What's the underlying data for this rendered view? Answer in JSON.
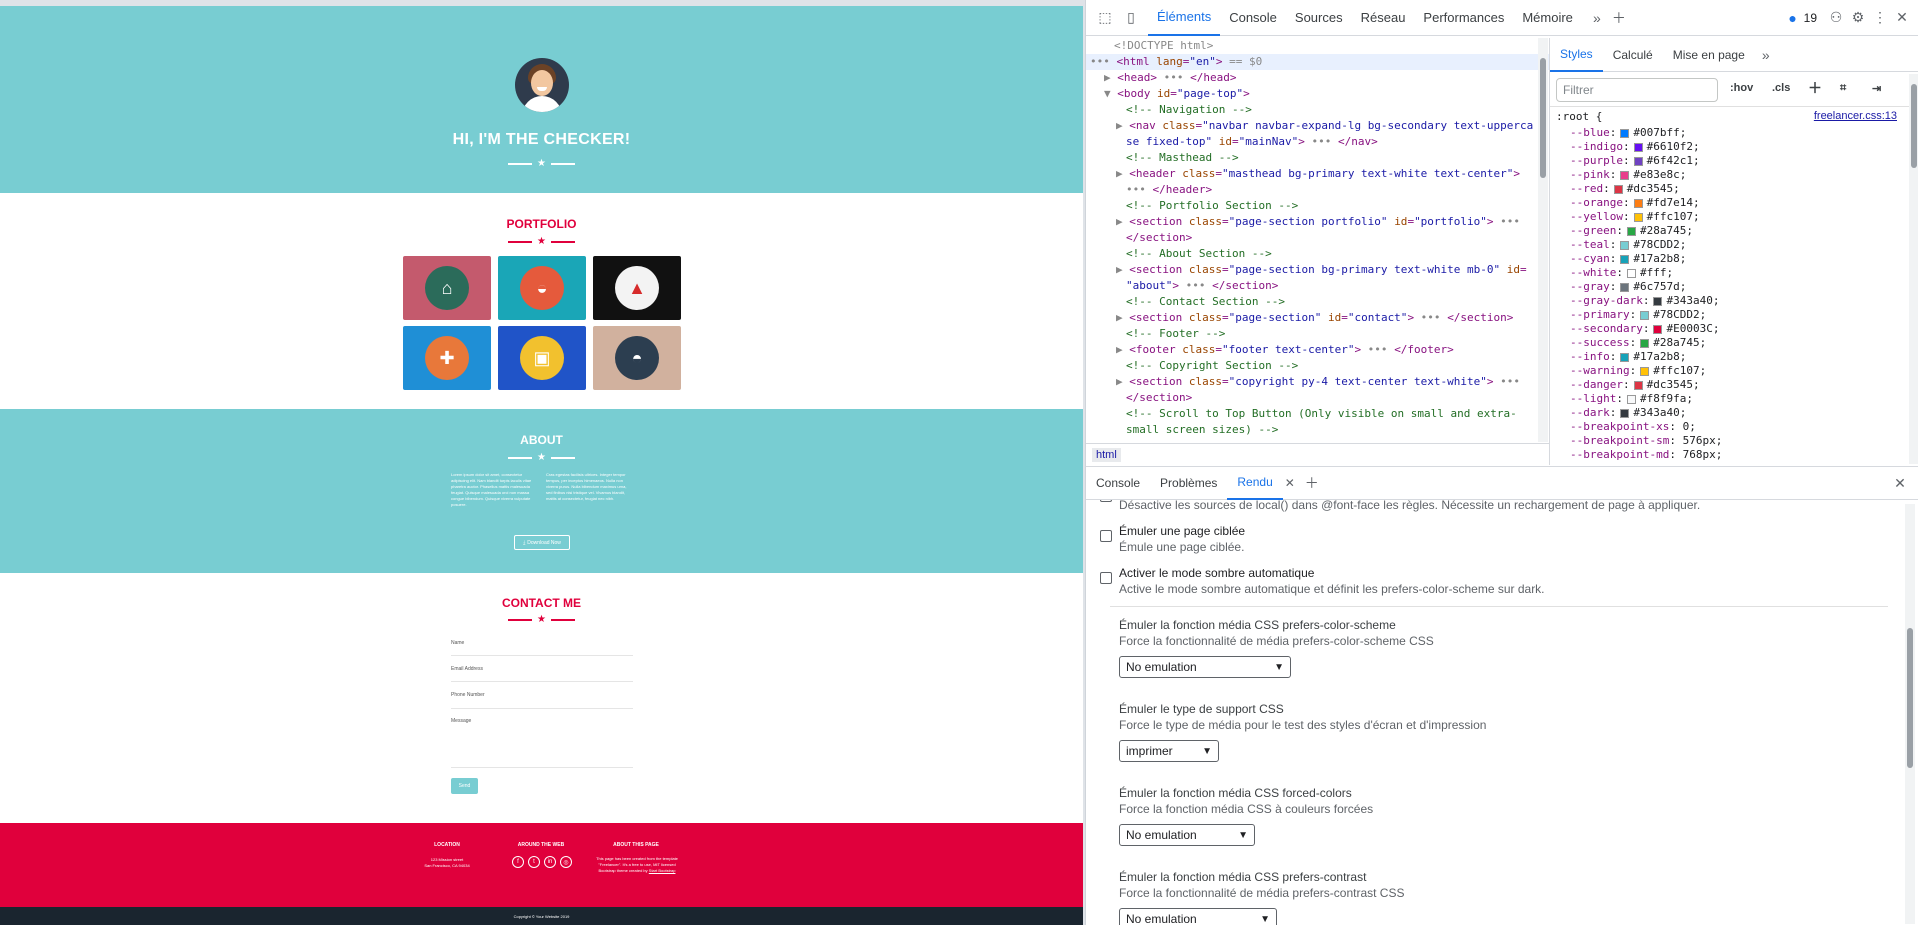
{
  "preview": {
    "masthead": {
      "title": "HI, I'M THE CHECKER!"
    },
    "portfolio": {
      "title": "PORTFOLIO",
      "items": [
        {
          "label": "cabin",
          "bg": "#C45A6D",
          "circle": "#2b6b5a",
          "glyph": "⌂"
        },
        {
          "label": "cake",
          "bg": "#1aa6b7",
          "circle": "#e55a3c",
          "glyph": "◒"
        },
        {
          "label": "circus",
          "bg": "#111111",
          "circle": "#f3f3f3",
          "glyph": "▲"
        },
        {
          "label": "game",
          "bg": "#1f8fd6",
          "circle": "#e8783a",
          "glyph": "✚"
        },
        {
          "label": "safe",
          "bg": "#2054c8",
          "circle": "#f2c12e",
          "glyph": "▣"
        },
        {
          "label": "submarine",
          "bg": "#d1b19e",
          "circle": "#2c3e50",
          "glyph": "◓"
        }
      ]
    },
    "about": {
      "title": "ABOUT",
      "col1": "Lorem ipsum dolor sit amet, consectetur adipiscing elit. Nam blandit turpis iaculis vitae pharetra auctor. Phasellus mattis malesuada feugiat. Quisque malesuada orci non massa congue bibendum. Quisque viverra vulputate posuere.",
      "col2": "Cras egestas facilisis ultrices. Integer tempor tempus, per inceptos himenaeos. Nulla non viverra purus. Nulla bibendum maximus urna, sed finibus nisi tristique vel. Vivamus blandit, mattis at consectetur, feugiat nec nibh.",
      "button": "Download Now"
    },
    "contact": {
      "title": "CONTACT ME",
      "fields": [
        "Name",
        "Email Address",
        "Phone Number",
        "Message"
      ],
      "send": "Send"
    },
    "footer": {
      "location_title": "LOCATION",
      "location_text": "123 Mission street\nSan Francisco, CA 94034",
      "web_title": "AROUND THE WEB",
      "social": [
        "f",
        "t",
        "in",
        "◎"
      ],
      "about_title": "ABOUT THIS PAGE",
      "about_text": "This page has been created from the template \"Freelancer\". It's a free to use, MIT licensed Bootstrap theme created by",
      "about_link": "Start Bootstrap",
      "copyright": "Copyright © Your Website 2019"
    }
  },
  "devtools": {
    "tabs": [
      "Éléments",
      "Console",
      "Sources",
      "Réseau",
      "Performances",
      "Mémoire"
    ],
    "issues_count": "19",
    "elements_lines": [
      {
        "indent": 1,
        "parts": [
          [
            "dim",
            "<!DOCTYPE html>"
          ]
        ]
      },
      {
        "indent": 0,
        "prefix": "••• ",
        "selected": true,
        "parts": [
          [
            "tag",
            "<html "
          ],
          [
            "attr",
            "lang"
          ],
          [
            "tag",
            "="
          ],
          [
            "val",
            "\"en\""
          ],
          [
            "tag",
            ">"
          ],
          [
            "dim",
            " == $0"
          ]
        ]
      },
      {
        "indent": 1,
        "prefix": "▶ ",
        "parts": [
          [
            "tag",
            "<head>"
          ],
          [
            "dim",
            " ••• "
          ],
          [
            "tag",
            "</head>"
          ]
        ]
      },
      {
        "indent": 1,
        "prefix": "▼ ",
        "parts": [
          [
            "tag",
            "<body "
          ],
          [
            "attr",
            "id"
          ],
          [
            "tag",
            "="
          ],
          [
            "val",
            "\"page-top\""
          ],
          [
            "tag",
            ">"
          ]
        ]
      },
      {
        "indent": 2,
        "parts": [
          [
            "cmt",
            "<!-- Navigation -->"
          ]
        ]
      },
      {
        "indent": 2,
        "prefix": "▶ ",
        "parts": [
          [
            "tag",
            "<nav "
          ],
          [
            "attr",
            "class"
          ],
          [
            "tag",
            "="
          ],
          [
            "val",
            "\"navbar navbar-expand-lg bg-secondary text-upperca"
          ]
        ]
      },
      {
        "indent": 2,
        "parts": [
          [
            "val",
            "se fixed-top\" "
          ],
          [
            "attr",
            "id"
          ],
          [
            "tag",
            "="
          ],
          [
            "val",
            "\"mainNav\""
          ],
          [
            "tag",
            ">"
          ],
          [
            "dim",
            " ••• "
          ],
          [
            "tag",
            "</nav>"
          ]
        ]
      },
      {
        "indent": 2,
        "parts": [
          [
            "cmt",
            "<!-- Masthead -->"
          ]
        ]
      },
      {
        "indent": 2,
        "prefix": "▶ ",
        "parts": [
          [
            "tag",
            "<header "
          ],
          [
            "attr",
            "class"
          ],
          [
            "tag",
            "="
          ],
          [
            "val",
            "\"masthead bg-primary text-white text-center\""
          ],
          [
            "tag",
            ">"
          ]
        ]
      },
      {
        "indent": 2,
        "parts": [
          [
            "dim",
            "••• "
          ],
          [
            "tag",
            "</header>"
          ]
        ]
      },
      {
        "indent": 2,
        "parts": [
          [
            "cmt",
            "<!-- Portfolio Section -->"
          ]
        ]
      },
      {
        "indent": 2,
        "prefix": "▶ ",
        "parts": [
          [
            "tag",
            "<section "
          ],
          [
            "attr",
            "class"
          ],
          [
            "tag",
            "="
          ],
          [
            "val",
            "\"page-section portfolio\" "
          ],
          [
            "attr",
            "id"
          ],
          [
            "tag",
            "="
          ],
          [
            "val",
            "\"portfolio\""
          ],
          [
            "tag",
            ">"
          ],
          [
            "dim",
            " •••"
          ]
        ]
      },
      {
        "indent": 2,
        "parts": [
          [
            "tag",
            "</section>"
          ]
        ]
      },
      {
        "indent": 2,
        "parts": [
          [
            "cmt",
            "<!-- About Section -->"
          ]
        ]
      },
      {
        "indent": 2,
        "prefix": "▶ ",
        "parts": [
          [
            "tag",
            "<section "
          ],
          [
            "attr",
            "class"
          ],
          [
            "tag",
            "="
          ],
          [
            "val",
            "\"page-section bg-primary text-white mb-0\" "
          ],
          [
            "attr",
            "id"
          ],
          [
            "tag",
            "="
          ]
        ]
      },
      {
        "indent": 2,
        "parts": [
          [
            "val",
            "\"about\""
          ],
          [
            "tag",
            ">"
          ],
          [
            "dim",
            " ••• "
          ],
          [
            "tag",
            "</section>"
          ]
        ]
      },
      {
        "indent": 2,
        "parts": [
          [
            "cmt",
            "<!-- Contact Section -->"
          ]
        ]
      },
      {
        "indent": 2,
        "prefix": "▶ ",
        "parts": [
          [
            "tag",
            "<section "
          ],
          [
            "attr",
            "class"
          ],
          [
            "tag",
            "="
          ],
          [
            "val",
            "\"page-section\" "
          ],
          [
            "attr",
            "id"
          ],
          [
            "tag",
            "="
          ],
          [
            "val",
            "\"contact\""
          ],
          [
            "tag",
            ">"
          ],
          [
            "dim",
            " ••• "
          ],
          [
            "tag",
            "</section>"
          ]
        ]
      },
      {
        "indent": 2,
        "parts": [
          [
            "cmt",
            "<!-- Footer -->"
          ]
        ]
      },
      {
        "indent": 2,
        "prefix": "▶ ",
        "parts": [
          [
            "tag",
            "<footer "
          ],
          [
            "attr",
            "class"
          ],
          [
            "tag",
            "="
          ],
          [
            "val",
            "\"footer text-center\""
          ],
          [
            "tag",
            ">"
          ],
          [
            "dim",
            " ••• "
          ],
          [
            "tag",
            "</footer>"
          ]
        ]
      },
      {
        "indent": 2,
        "parts": [
          [
            "cmt",
            "<!-- Copyright Section -->"
          ]
        ]
      },
      {
        "indent": 2,
        "prefix": "▶ ",
        "parts": [
          [
            "tag",
            "<section "
          ],
          [
            "attr",
            "class"
          ],
          [
            "tag",
            "="
          ],
          [
            "val",
            "\"copyright py-4 text-center text-white\""
          ],
          [
            "tag",
            ">"
          ],
          [
            "dim",
            " •••"
          ]
        ]
      },
      {
        "indent": 2,
        "parts": [
          [
            "tag",
            "</section>"
          ]
        ]
      },
      {
        "indent": 2,
        "parts": [
          [
            "cmt",
            "<!-- Scroll to Top Button (Only visible on small and extra-"
          ]
        ]
      },
      {
        "indent": 2,
        "parts": [
          [
            "cmt",
            "small screen sizes) -->"
          ]
        ]
      }
    ],
    "breadcrumb": "html",
    "styles": {
      "tabs": [
        "Styles",
        "Calculé",
        "Mise en page"
      ],
      "filter_placeholder": "Filtrer",
      "hov": ":hov",
      "cls": ".cls",
      "selector": ":root {",
      "source": "freelancer.css:13",
      "vars": [
        {
          "name": "--blue",
          "value": "#007bff",
          "color": "#007bff"
        },
        {
          "name": "--indigo",
          "value": "#6610f2",
          "color": "#6610f2"
        },
        {
          "name": "--purple",
          "value": "#6f42c1",
          "color": "#6f42c1"
        },
        {
          "name": "--pink",
          "value": "#e83e8c",
          "color": "#e83e8c"
        },
        {
          "name": "--red",
          "value": "#dc3545",
          "color": "#dc3545"
        },
        {
          "name": "--orange",
          "value": "#fd7e14",
          "color": "#fd7e14"
        },
        {
          "name": "--yellow",
          "value": "#ffc107",
          "color": "#ffc107"
        },
        {
          "name": "--green",
          "value": "#28a745",
          "color": "#28a745"
        },
        {
          "name": "--teal",
          "value": "#78CDD2",
          "color": "#78CDD2"
        },
        {
          "name": "--cyan",
          "value": "#17a2b8",
          "color": "#17a2b8"
        },
        {
          "name": "--white",
          "value": "#fff",
          "color": "#ffffff"
        },
        {
          "name": "--gray",
          "value": "#6c757d",
          "color": "#6c757d"
        },
        {
          "name": "--gray-dark",
          "value": "#343a40",
          "color": "#343a40"
        },
        {
          "name": "--primary",
          "value": "#78CDD2",
          "color": "#78CDD2"
        },
        {
          "name": "--secondary",
          "value": "#E0003C",
          "color": "#E0003C"
        },
        {
          "name": "--success",
          "value": "#28a745",
          "color": "#28a745"
        },
        {
          "name": "--info",
          "value": "#17a2b8",
          "color": "#17a2b8"
        },
        {
          "name": "--warning",
          "value": "#ffc107",
          "color": "#ffc107"
        },
        {
          "name": "--danger",
          "value": "#dc3545",
          "color": "#dc3545"
        },
        {
          "name": "--light",
          "value": "#f8f9fa",
          "color": "#f8f9fa"
        },
        {
          "name": "--dark",
          "value": "#343a40",
          "color": "#343a40"
        },
        {
          "name": "--breakpoint-xs",
          "value": "0",
          "color": ""
        },
        {
          "name": "--breakpoint-sm",
          "value": "576px",
          "color": ""
        },
        {
          "name": "--breakpoint-md",
          "value": "768px",
          "color": ""
        }
      ]
    },
    "drawer": {
      "tabs": [
        "Console",
        "Problèmes",
        "Rendu"
      ],
      "first_line": "Désactive les sources de local() dans @font-face les règles. Nécessite un rechargement de page à appliquer.",
      "checkboxes": [
        {
          "title": "Émuler une page ciblée",
          "desc": "Émule une page ciblée."
        },
        {
          "title": "Activer le mode sombre automatique",
          "desc": "Active le mode sombre automatique et définit les prefers-color-scheme sur dark."
        }
      ],
      "selects": [
        {
          "title": "Émuler la fonction média CSS prefers-color-scheme",
          "desc": "Force la fonctionnalité de média prefers-color-scheme CSS",
          "value": "No emulation"
        },
        {
          "title": "Émuler le type de support CSS",
          "desc": "Force le type de média pour le test des styles d'écran et d'impression",
          "value": "imprimer"
        },
        {
          "title": "Émuler la fonction média CSS forced-colors",
          "desc": "Force la fonction média CSS à couleurs forcées",
          "value": "No emulation"
        },
        {
          "title": "Émuler la fonction média CSS prefers-contrast",
          "desc": "Force la fonctionnalité de média prefers-contrast CSS",
          "value": "No emulation"
        }
      ]
    }
  }
}
